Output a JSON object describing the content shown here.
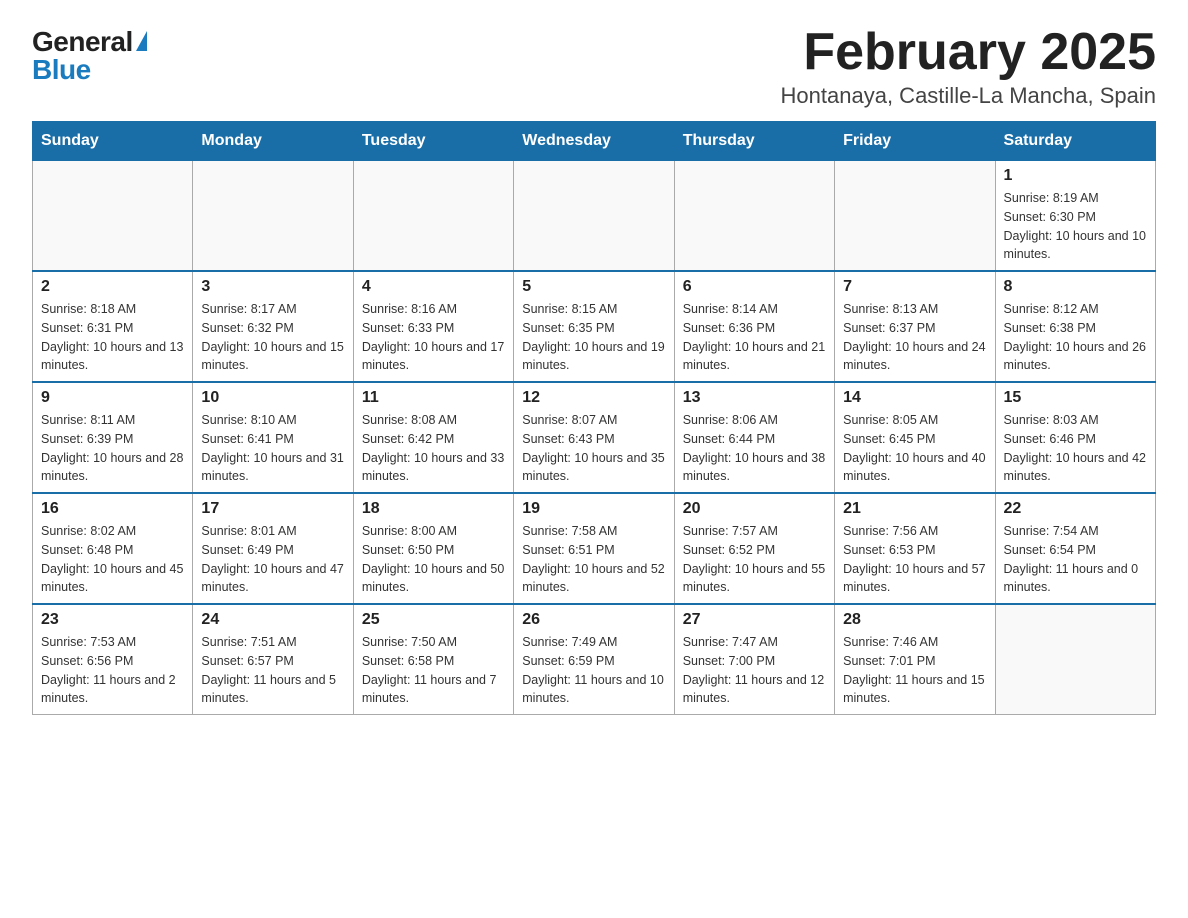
{
  "logo": {
    "general": "General",
    "blue": "Blue",
    "aria": "GeneralBlue logo"
  },
  "title": "February 2025",
  "subtitle": "Hontanaya, Castille-La Mancha, Spain",
  "weekdays": [
    "Sunday",
    "Monday",
    "Tuesday",
    "Wednesday",
    "Thursday",
    "Friday",
    "Saturday"
  ],
  "weeks": [
    [
      {
        "day": "",
        "info": ""
      },
      {
        "day": "",
        "info": ""
      },
      {
        "day": "",
        "info": ""
      },
      {
        "day": "",
        "info": ""
      },
      {
        "day": "",
        "info": ""
      },
      {
        "day": "",
        "info": ""
      },
      {
        "day": "1",
        "info": "Sunrise: 8:19 AM\nSunset: 6:30 PM\nDaylight: 10 hours and 10 minutes."
      }
    ],
    [
      {
        "day": "2",
        "info": "Sunrise: 8:18 AM\nSunset: 6:31 PM\nDaylight: 10 hours and 13 minutes."
      },
      {
        "day": "3",
        "info": "Sunrise: 8:17 AM\nSunset: 6:32 PM\nDaylight: 10 hours and 15 minutes."
      },
      {
        "day": "4",
        "info": "Sunrise: 8:16 AM\nSunset: 6:33 PM\nDaylight: 10 hours and 17 minutes."
      },
      {
        "day": "5",
        "info": "Sunrise: 8:15 AM\nSunset: 6:35 PM\nDaylight: 10 hours and 19 minutes."
      },
      {
        "day": "6",
        "info": "Sunrise: 8:14 AM\nSunset: 6:36 PM\nDaylight: 10 hours and 21 minutes."
      },
      {
        "day": "7",
        "info": "Sunrise: 8:13 AM\nSunset: 6:37 PM\nDaylight: 10 hours and 24 minutes."
      },
      {
        "day": "8",
        "info": "Sunrise: 8:12 AM\nSunset: 6:38 PM\nDaylight: 10 hours and 26 minutes."
      }
    ],
    [
      {
        "day": "9",
        "info": "Sunrise: 8:11 AM\nSunset: 6:39 PM\nDaylight: 10 hours and 28 minutes."
      },
      {
        "day": "10",
        "info": "Sunrise: 8:10 AM\nSunset: 6:41 PM\nDaylight: 10 hours and 31 minutes."
      },
      {
        "day": "11",
        "info": "Sunrise: 8:08 AM\nSunset: 6:42 PM\nDaylight: 10 hours and 33 minutes."
      },
      {
        "day": "12",
        "info": "Sunrise: 8:07 AM\nSunset: 6:43 PM\nDaylight: 10 hours and 35 minutes."
      },
      {
        "day": "13",
        "info": "Sunrise: 8:06 AM\nSunset: 6:44 PM\nDaylight: 10 hours and 38 minutes."
      },
      {
        "day": "14",
        "info": "Sunrise: 8:05 AM\nSunset: 6:45 PM\nDaylight: 10 hours and 40 minutes."
      },
      {
        "day": "15",
        "info": "Sunrise: 8:03 AM\nSunset: 6:46 PM\nDaylight: 10 hours and 42 minutes."
      }
    ],
    [
      {
        "day": "16",
        "info": "Sunrise: 8:02 AM\nSunset: 6:48 PM\nDaylight: 10 hours and 45 minutes."
      },
      {
        "day": "17",
        "info": "Sunrise: 8:01 AM\nSunset: 6:49 PM\nDaylight: 10 hours and 47 minutes."
      },
      {
        "day": "18",
        "info": "Sunrise: 8:00 AM\nSunset: 6:50 PM\nDaylight: 10 hours and 50 minutes."
      },
      {
        "day": "19",
        "info": "Sunrise: 7:58 AM\nSunset: 6:51 PM\nDaylight: 10 hours and 52 minutes."
      },
      {
        "day": "20",
        "info": "Sunrise: 7:57 AM\nSunset: 6:52 PM\nDaylight: 10 hours and 55 minutes."
      },
      {
        "day": "21",
        "info": "Sunrise: 7:56 AM\nSunset: 6:53 PM\nDaylight: 10 hours and 57 minutes."
      },
      {
        "day": "22",
        "info": "Sunrise: 7:54 AM\nSunset: 6:54 PM\nDaylight: 11 hours and 0 minutes."
      }
    ],
    [
      {
        "day": "23",
        "info": "Sunrise: 7:53 AM\nSunset: 6:56 PM\nDaylight: 11 hours and 2 minutes."
      },
      {
        "day": "24",
        "info": "Sunrise: 7:51 AM\nSunset: 6:57 PM\nDaylight: 11 hours and 5 minutes."
      },
      {
        "day": "25",
        "info": "Sunrise: 7:50 AM\nSunset: 6:58 PM\nDaylight: 11 hours and 7 minutes."
      },
      {
        "day": "26",
        "info": "Sunrise: 7:49 AM\nSunset: 6:59 PM\nDaylight: 11 hours and 10 minutes."
      },
      {
        "day": "27",
        "info": "Sunrise: 7:47 AM\nSunset: 7:00 PM\nDaylight: 11 hours and 12 minutes."
      },
      {
        "day": "28",
        "info": "Sunrise: 7:46 AM\nSunset: 7:01 PM\nDaylight: 11 hours and 15 minutes."
      },
      {
        "day": "",
        "info": ""
      }
    ]
  ]
}
